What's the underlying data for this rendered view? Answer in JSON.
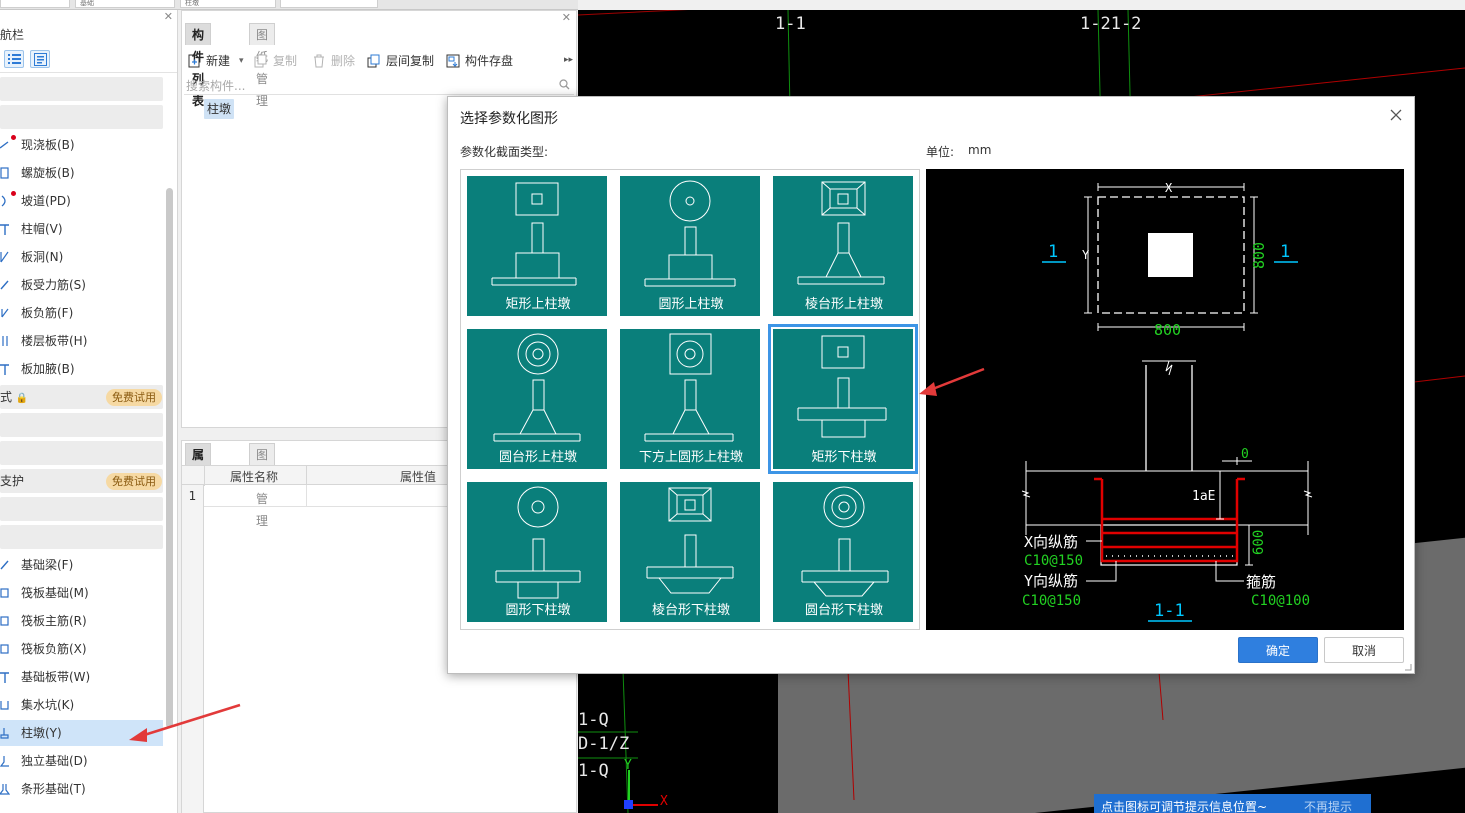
{
  "top_strip": {
    "segments": [
      "",
      "基础",
      "柱墩",
      ""
    ]
  },
  "left_panel": {
    "nav_label": "航栏",
    "groups": [
      {
        "label": "",
        "badge": ""
      },
      {
        "label": "",
        "badge": ""
      },
      {
        "label": "式",
        "badge": "免费试用"
      },
      {
        "label": "",
        "badge": ""
      },
      {
        "label": "",
        "badge": ""
      },
      {
        "label": "支护",
        "badge": "免费试用"
      },
      {
        "label": "",
        "badge": ""
      },
      {
        "label": "",
        "badge": ""
      }
    ],
    "items": [
      {
        "label": "现浇板(B)",
        "dot": true
      },
      {
        "label": "螺旋板(B)",
        "dot": false
      },
      {
        "label": "坡道(PD)",
        "dot": true
      },
      {
        "label": "柱帽(V)",
        "dot": false
      },
      {
        "label": "板洞(N)",
        "dot": false
      },
      {
        "label": "板受力筋(S)",
        "dot": false
      },
      {
        "label": "板负筋(F)",
        "dot": false
      },
      {
        "label": "楼层板带(H)",
        "dot": false
      },
      {
        "label": "板加腋(B)",
        "dot": false
      },
      {
        "label": "基础梁(F)",
        "dot": false
      },
      {
        "label": "筏板基础(M)",
        "dot": false
      },
      {
        "label": "筏板主筋(R)",
        "dot": false
      },
      {
        "label": "筏板负筋(X)",
        "dot": false
      },
      {
        "label": "基础板带(W)",
        "dot": false
      },
      {
        "label": "集水坑(K)",
        "dot": false
      },
      {
        "label": "柱墩(Y)",
        "dot": false
      },
      {
        "label": "独立基础(D)",
        "dot": false
      },
      {
        "label": "条形基础(T)",
        "dot": false
      }
    ]
  },
  "component_panel": {
    "tabs": [
      "构件列表",
      "图纸管理"
    ],
    "toolbar": {
      "new": "新建",
      "copy": "复制",
      "delete": "删除",
      "floor_copy": "层间复制",
      "save_component": "构件存盘"
    },
    "search_placeholder": "搜索构件...",
    "tree_item": "柱墩"
  },
  "property_panel": {
    "tabs": [
      "属性列表",
      "图层管理"
    ],
    "col_name": "属性名称",
    "col_value": "属性值",
    "row_number": "1"
  },
  "cad": {
    "labels": [
      "1-1",
      "1-21-2",
      "1-Q",
      "D-1/Z",
      "1-Q",
      "Y",
      "X"
    ]
  },
  "tip_bar": {
    "text": "点击图标可调节提示信息位置~",
    "dismiss": "不再提示"
  },
  "dialog": {
    "title": "选择参数化图形",
    "section_label": "参数化截面类型:",
    "unit_label": "单位:",
    "unit_value": "mm",
    "shapes": [
      "矩形上柱墩",
      "圆形上柱墩",
      "棱台形上柱墩",
      "圆台形上柱墩",
      "下方上圆形上柱墩",
      "矩形下柱墩",
      "圆形下柱墩",
      "棱台形下柱墩",
      "圆台形下柱墩"
    ],
    "selected_index": 5,
    "preview": {
      "plan_x": "X",
      "plan_y": "Y",
      "plan_width": "800",
      "plan_height": "800",
      "section_mark_left": "1",
      "section_mark_right": "1",
      "cover": "0",
      "anchor": "1aE",
      "depth": "600",
      "x_rebar_label": "X向纵筋",
      "x_rebar_value": "C10@150",
      "y_rebar_label": "Y向纵筋",
      "y_rebar_value": "C10@150",
      "stirrup_label": "箍筋",
      "stirrup_value": "C10@100",
      "section_title": "1-1"
    },
    "ok": "确定",
    "cancel": "取消"
  },
  "colors": {
    "accent": "#2f7fdf",
    "teal_tile": "#0a7f7b",
    "selection": "#3d95e6",
    "rebar_red": "#e00000",
    "dim_green": "#22d122",
    "cad_cyan": "#00c8ff"
  }
}
